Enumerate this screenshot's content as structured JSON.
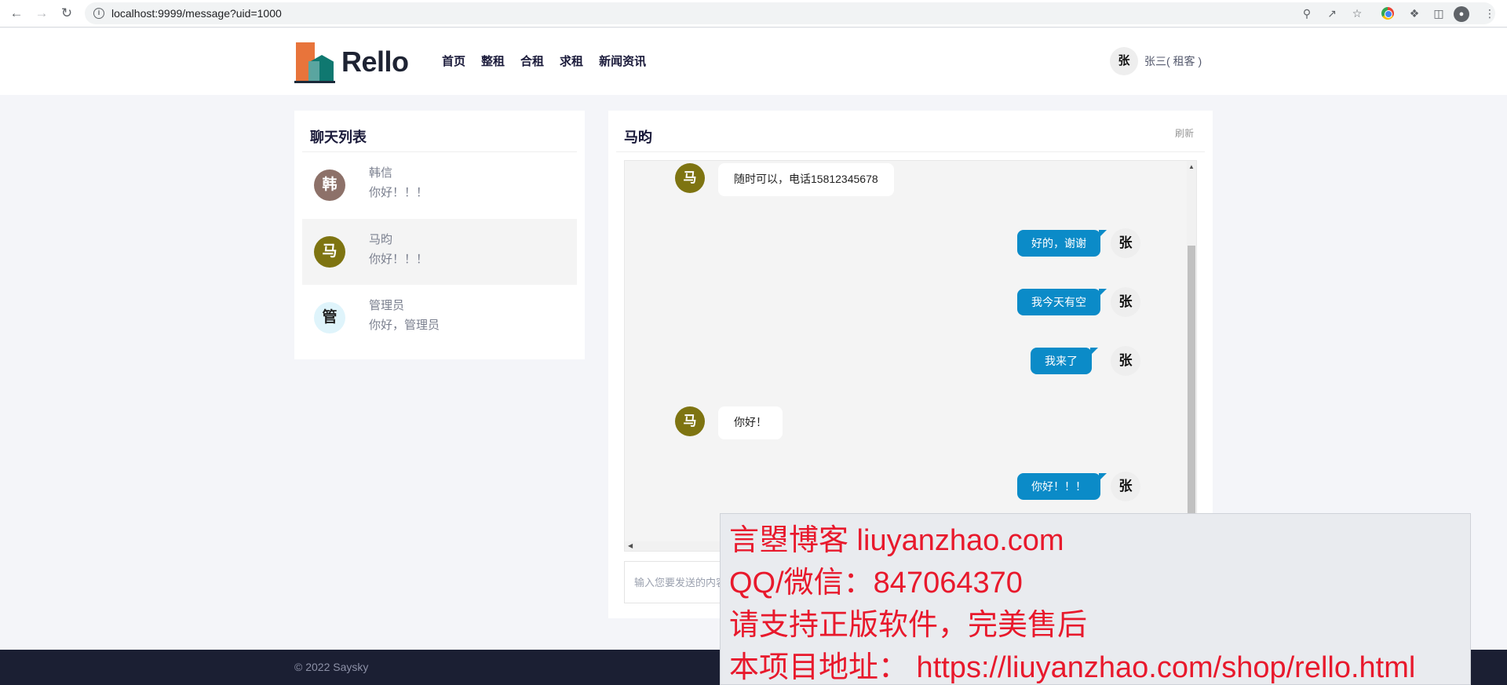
{
  "browser": {
    "url": "localhost:9999/message?uid=1000"
  },
  "header": {
    "logo_text": "Rello",
    "nav": [
      "首页",
      "整租",
      "合租",
      "求租",
      "新闻资讯"
    ],
    "user": {
      "avatar_char": "张",
      "name": "张三( 租客 )"
    }
  },
  "chat_list": {
    "title": "聊天列表",
    "contacts": [
      {
        "avatar_char": "韩",
        "avatar_color": "#8d7169",
        "name": "韩信",
        "last_message": "你好！！！",
        "active": false
      },
      {
        "avatar_char": "马",
        "avatar_color": "#7e7411",
        "name": "马昀",
        "last_message": "你好！！！",
        "active": true
      },
      {
        "avatar_char": "管",
        "avatar_color": "#dff4fb",
        "name": "管理员",
        "last_message": "你好，管理员",
        "active": false
      }
    ]
  },
  "chat": {
    "title": "马昀",
    "refresh_label": "刷新",
    "messages": [
      {
        "direction": "in",
        "avatar_char": "马",
        "text": "随时可以，电话15812345678"
      },
      {
        "direction": "out",
        "avatar_char": "张",
        "text": "好的，谢谢"
      },
      {
        "direction": "out",
        "avatar_char": "张",
        "text": "我今天有空"
      },
      {
        "direction": "out",
        "avatar_char": "张",
        "text": "我来了"
      },
      {
        "direction": "in",
        "avatar_char": "马",
        "text": "你好！"
      },
      {
        "direction": "out",
        "avatar_char": "张",
        "text": "你好！！！"
      }
    ],
    "input_placeholder": "输入您要发送的内容"
  },
  "footer": {
    "copyright": "© 2022 Saysky"
  },
  "watermark": {
    "lines": [
      "言曌博客 liuyanzhao.com",
      "QQ/微信：847064370",
      "请支持正版软件，完美售后",
      "本项目地址： https://liuyanzhao.com/shop/rello.html"
    ]
  },
  "colors": {
    "accent_blue": "#0b8bc8",
    "footer_bg": "#1b1f33",
    "watermark_red": "#e8192c",
    "logo_orange": "#e8743b",
    "logo_teal": "#0f7870"
  }
}
